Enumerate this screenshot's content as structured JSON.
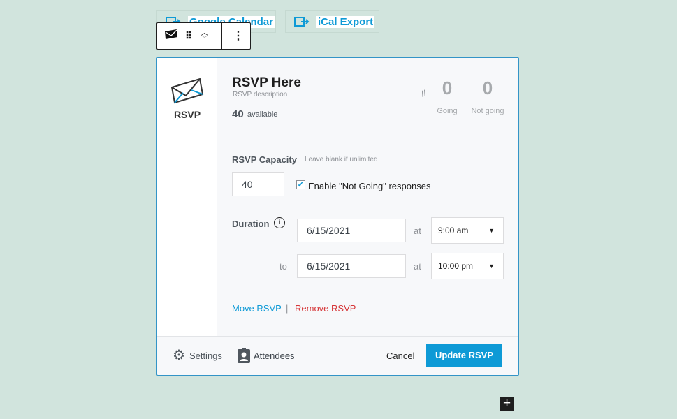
{
  "exports": [
    {
      "label": "Google Calendar",
      "icon": "calendar-export-icon"
    },
    {
      "label": "iCal Export",
      "icon": "calendar-export-icon"
    }
  ],
  "toolbar": {
    "block_icon": "envelope-icon",
    "drag": "drag-handle-icon",
    "move": "chevron-up-down-icon",
    "more": "more-vertical-icon"
  },
  "sidebar": {
    "label": "RSVP",
    "icon": "envelope-icon"
  },
  "rsvp": {
    "title": "RSVP Here",
    "description": "RSVP description",
    "available_count": "40",
    "available_label": "available",
    "going_count": "0",
    "going_label": "Going",
    "not_going_count": "0",
    "not_going_label": "Not going"
  },
  "capacity": {
    "label": "RSVP Capacity",
    "hint": "Leave blank if unlimited",
    "value": "40",
    "not_going_label": "Enable \"Not Going\" responses",
    "not_going_checked": true
  },
  "duration": {
    "label": "Duration",
    "start_date": "6/15/2021",
    "start_time": "9:00 am",
    "to_label": "to",
    "end_date": "6/15/2021",
    "end_time": "10:00 pm",
    "at_label": "at"
  },
  "links": {
    "move": "Move RSVP",
    "separator": "|",
    "remove": "Remove RSVP"
  },
  "footer": {
    "settings": "Settings",
    "attendees": "Attendees",
    "cancel": "Cancel",
    "update": "Update RSVP"
  },
  "colors": {
    "accent": "#0e9ad6",
    "danger": "#d63638",
    "background": "#d1e4dd"
  }
}
